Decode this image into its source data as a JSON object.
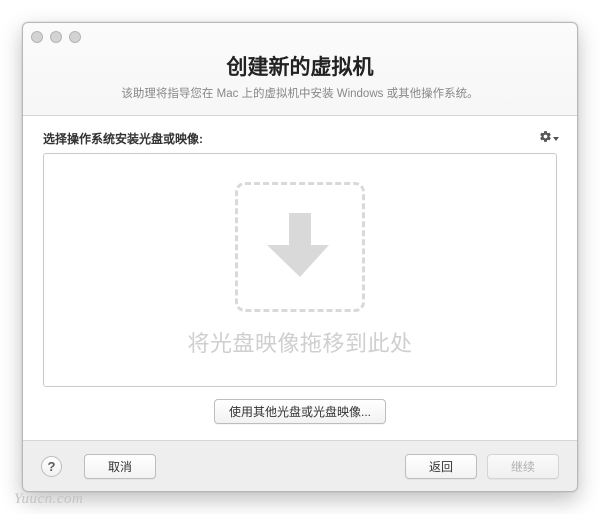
{
  "header": {
    "title": "创建新的虚拟机",
    "subtitle": "该助理将指导您在 Mac 上的虚拟机中安装 Windows 或其他操作系统。"
  },
  "content": {
    "section_label": "选择操作系统安装光盘或映像:",
    "gear_icon": "settings-icon",
    "dropzone_text": "将光盘映像拖移到此处",
    "other_disc_button": "使用其他光盘或光盘映像..."
  },
  "footer": {
    "help": "?",
    "cancel": "取消",
    "back": "返回",
    "continue": "继续"
  },
  "watermark": "Yuucn.com"
}
